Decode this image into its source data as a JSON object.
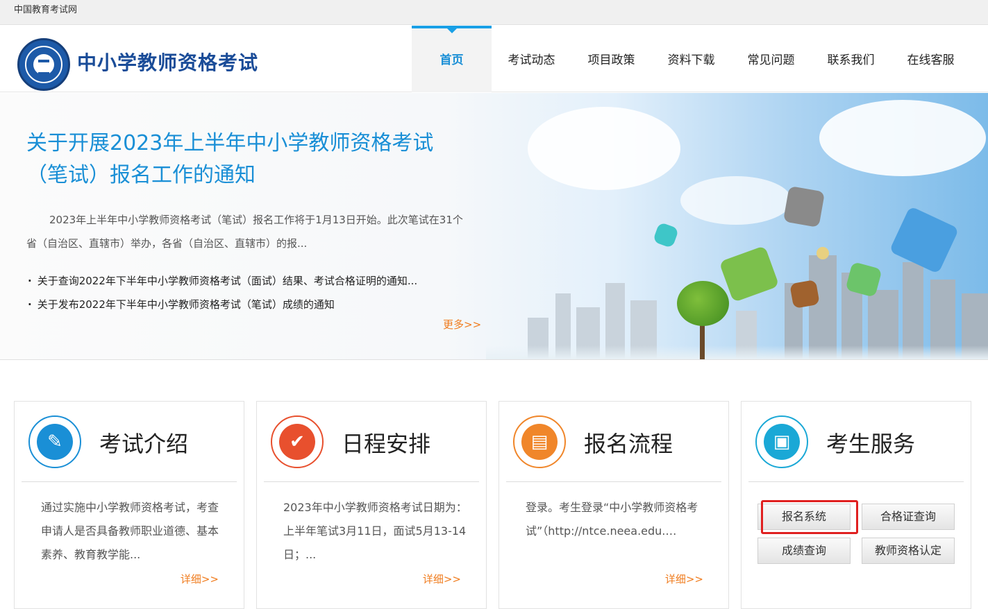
{
  "topbar": {
    "site_name": "中国教育考试网"
  },
  "header": {
    "title": "中小学教师资格考试",
    "nav": [
      {
        "label": "首页",
        "active": true
      },
      {
        "label": "考试动态"
      },
      {
        "label": "项目政策"
      },
      {
        "label": "资料下载"
      },
      {
        "label": "常见问题"
      },
      {
        "label": "联系我们"
      },
      {
        "label": "在线客服"
      }
    ]
  },
  "hero": {
    "title": "关于开展2023年上半年中小学教师资格考试（笔试）报名工作的通知",
    "desc": "2023年上半年中小学教师资格考试（笔试）报名工作将于1月13日开始。此次笔试在31个省（自治区、直辖市）举办，各省（自治区、直辖市）的报...",
    "news": [
      "关于查询2022年下半年中小学教师资格考试（面试）结果、考试合格证明的通知...",
      "关于发布2022年下半年中小学教师资格考试（笔试）成绩的通知"
    ],
    "more": "更多>>"
  },
  "cards": [
    {
      "title": "考试介绍",
      "body": "通过实施中小学教师资格考试，考查申请人是否具备教师职业道德、基本素养、教育教学能...",
      "more": "详细>>",
      "icon": "document-pen-icon",
      "color": "#1a8fd6"
    },
    {
      "title": "日程安排",
      "body": "2023年中小学教师资格考试日期为：上半年笔试3月11日，面试5月13-14日；...",
      "more": "详细>>",
      "icon": "checkmark-icon",
      "color": "#e8502e"
    },
    {
      "title": "报名流程",
      "body": "登录。考生登录“中小学教师资格考试”（http://ntce.neea.edu.…",
      "more": "详细>>",
      "icon": "form-icon",
      "color": "#f0862a"
    },
    {
      "title": "考生服务",
      "icon": "contact-book-icon",
      "color": "#1aa8d6",
      "buttons": [
        "报名系统",
        "合格证查询",
        "成绩查询",
        "教师资格认定"
      ]
    }
  ],
  "colors": {
    "accent": "#1a8fd6",
    "more": "#f07c1e",
    "highlight": "#e02020"
  }
}
